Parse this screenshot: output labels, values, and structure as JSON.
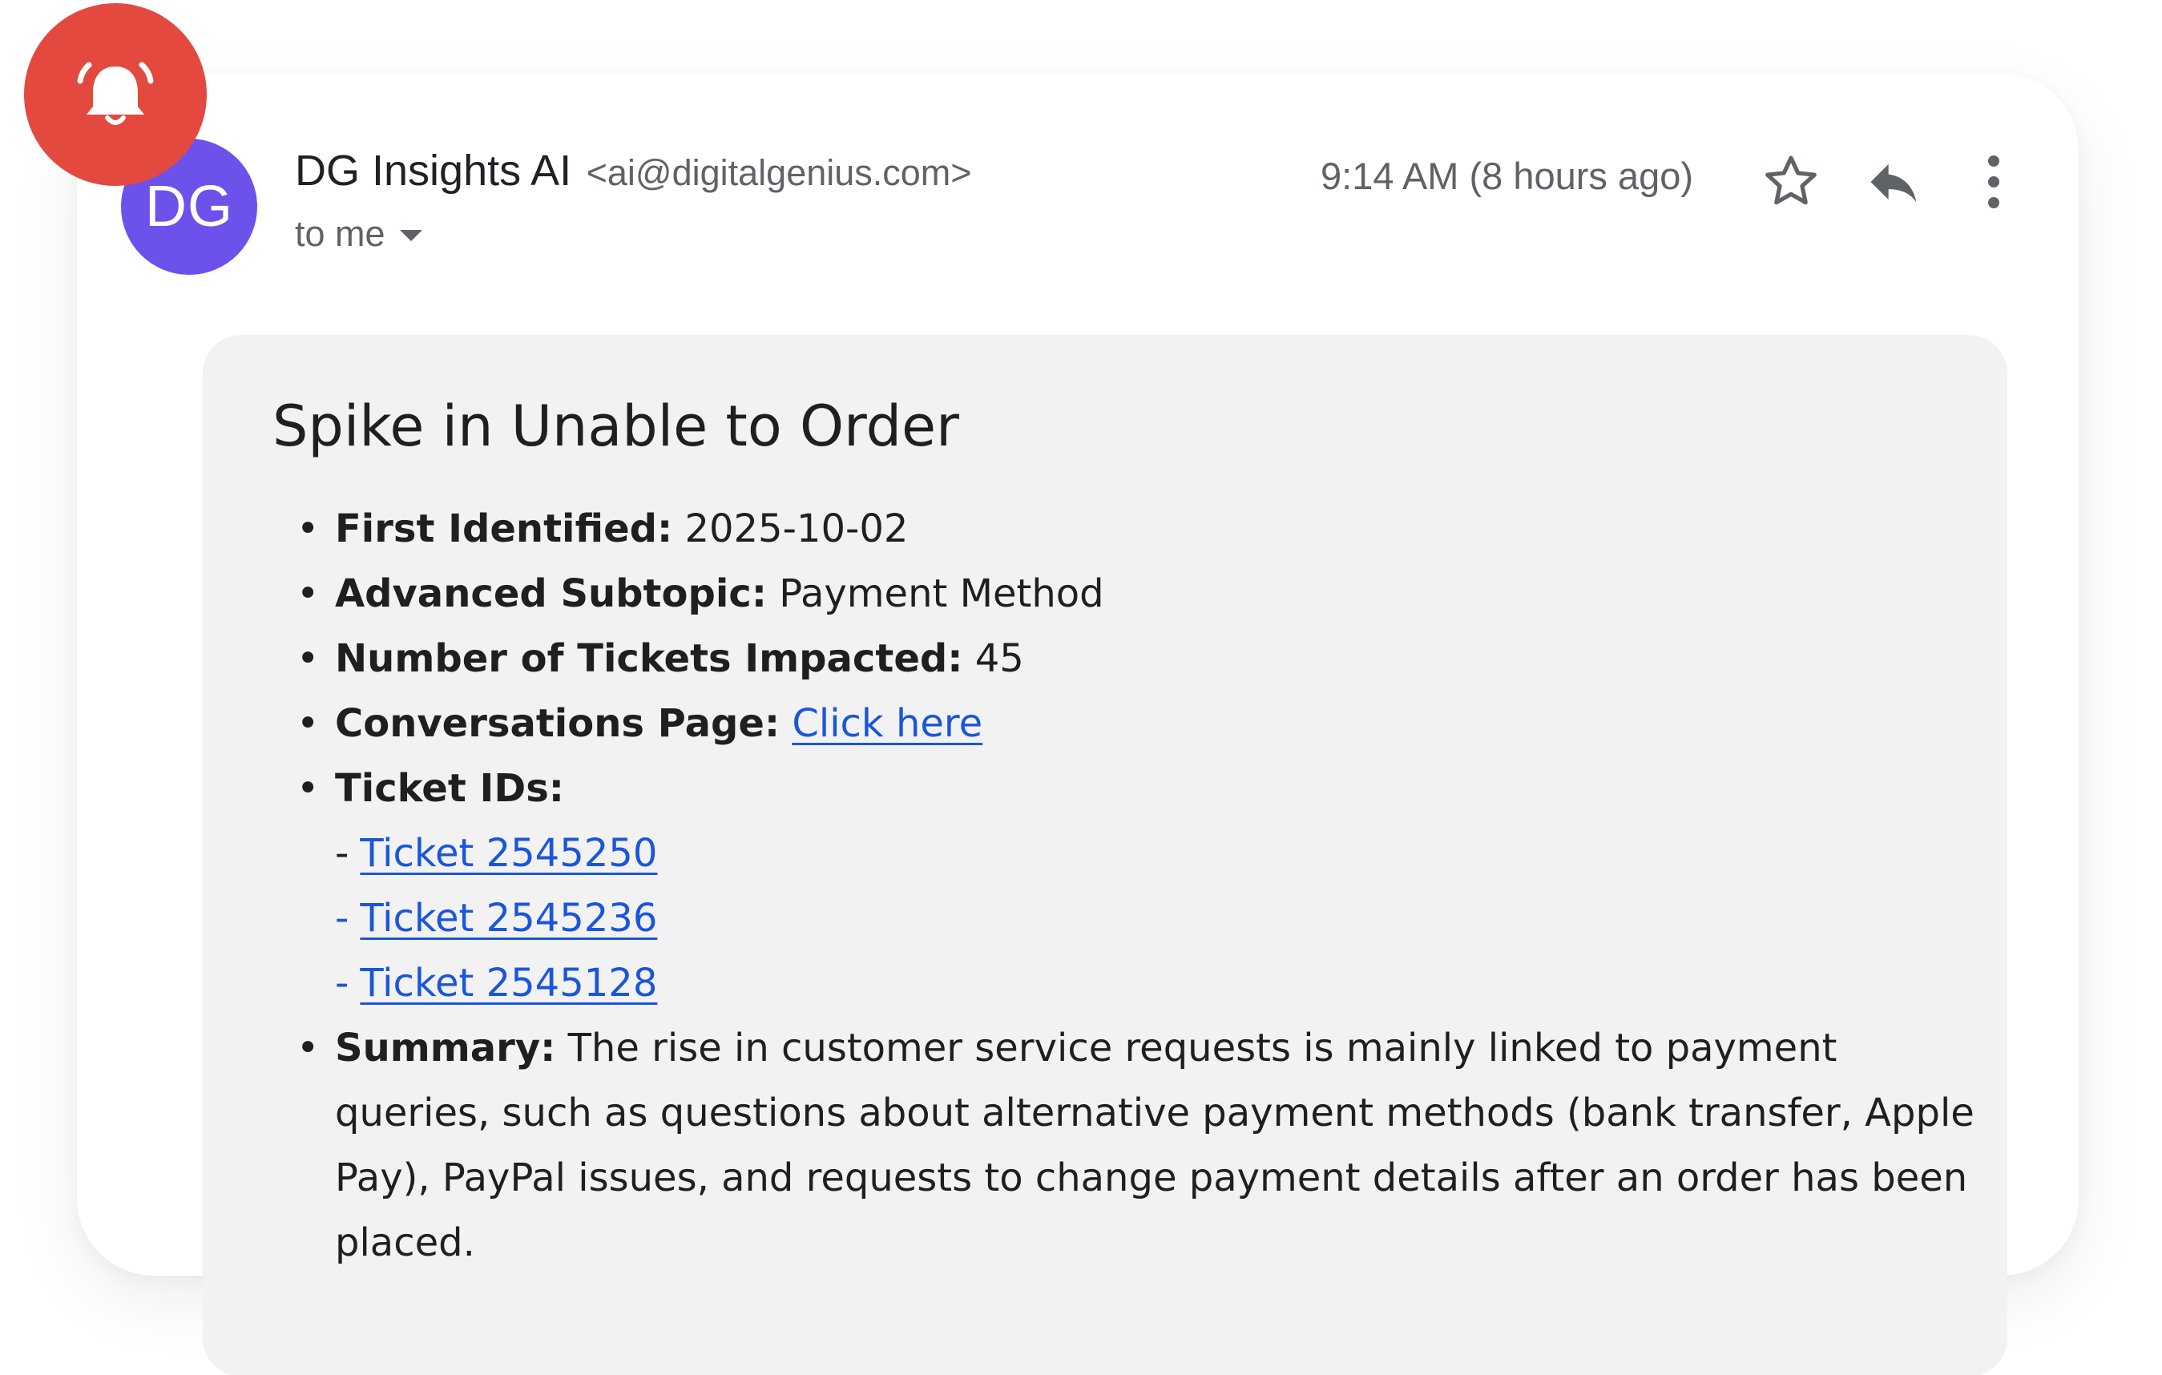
{
  "alert": {
    "icon": "bell-icon",
    "color": "#E4493F"
  },
  "sender": {
    "avatar_initials": "DG",
    "avatar_color": "#6C52EA",
    "name": "DG Insights AI",
    "email": "<ai@digitalgenius.com>",
    "recipient": "to me"
  },
  "header": {
    "timestamp": "9:14 AM (8 hours ago)",
    "star_icon": "star-outline-icon",
    "reply_icon": "reply-icon",
    "more_icon": "more-vertical-icon"
  },
  "message": {
    "title": "Spike in Unable to Order",
    "first_identified": {
      "label": "First Identified:",
      "value": "2025-10-02"
    },
    "subtopic": {
      "label": "Advanced Subtopic:",
      "value": "Payment Method"
    },
    "tickets_impacted": {
      "label": "Number of Tickets Impacted:",
      "value": "45"
    },
    "conversations": {
      "label": "Conversations Page:",
      "link_text": "Click here"
    },
    "ticket_ids": {
      "label": "Ticket IDs:",
      "items": [
        {
          "dash": "-",
          "text": "Ticket 2545250"
        },
        {
          "dash": "-",
          "text": "Ticket 2545236"
        },
        {
          "dash": "-",
          "text": "Ticket 2545128"
        }
      ]
    },
    "summary": {
      "label": "Summary:",
      "text": "The rise in customer service requests is mainly linked to payment queries, such as questions about alternative payment methods (bank transfer, Apple Pay), PayPal issues, and requests to change payment details after an order has been placed."
    },
    "bullet": "•",
    "link_color": "#1a56db"
  }
}
